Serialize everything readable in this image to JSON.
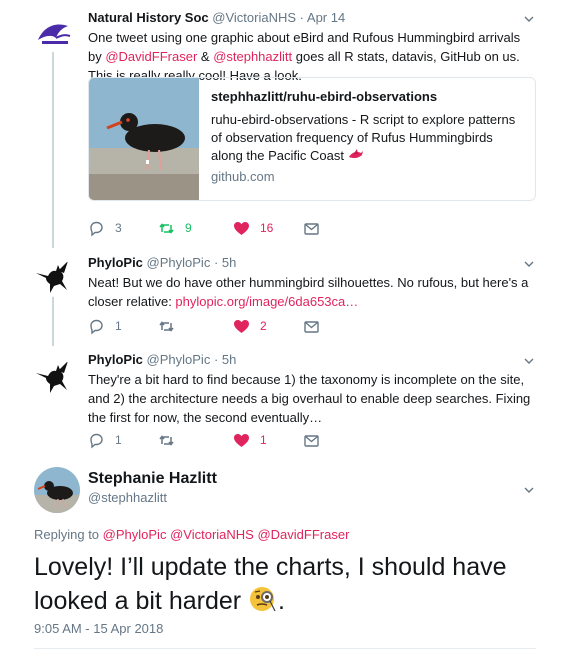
{
  "tweets": [
    {
      "name": "Natural History Soc",
      "handle": "@VictoriaNHS",
      "time": "· Apr 14",
      "text_parts": [
        "One tweet using one graphic about eBird and Rufous Hummingbird arrivals by ",
        "@DavidFFraser",
        " & ",
        "@stephhazlitt",
        " goes all R stats, datavis, GitHub on us. This is really really cool! Have a look."
      ],
      "card": {
        "title": "stephhazlitt/ruhu-ebird-observations",
        "description": "ruhu-ebird-observations - R script to explore patterns of observation frequency of Rufus Hummingbirds along the Pacific Coast",
        "domain": "github.com"
      },
      "replies": "3",
      "retweets": "9",
      "likes": "16"
    },
    {
      "name": "PhyloPic",
      "handle": "@PhyloPic",
      "time": "· 5h",
      "text_parts": [
        "Neat! But we do have other hummingbird silhouettes. No rufous, but here's a closer relative: ",
        "phylopic.org/image/6da653ca…"
      ],
      "replies": "1",
      "retweets": "",
      "likes": "2"
    },
    {
      "name": "PhyloPic",
      "handle": "@PhyloPic",
      "time": "· 5h",
      "text": "They're a bit hard to find because 1) the taxonomy is incomplete on the site, and 2) the architecture needs a big overhaul to enable deep searches. Fixing the first for now, the second eventually…",
      "replies": "1",
      "retweets": "",
      "likes": "1"
    }
  ],
  "main": {
    "name": "Stephanie Hazlitt",
    "handle": "@stephhazlitt",
    "replying_prefix": "Replying to",
    "replying_to": [
      "@PhyloPic",
      "@VictoriaNHS",
      "@DavidFFraser"
    ],
    "text": "Lovely! I’ll update the charts, I should have looked a bit harder ",
    "text_end": ".",
    "emoji": "face-with-monocle-icon",
    "timestamp": "9:05 AM - 15 Apr 2018"
  },
  "colors": {
    "link": "#e0245e",
    "like": "#e0245e",
    "retweet": "#17bf63",
    "muted": "#657786",
    "brand_purple": "#4a2ca8"
  }
}
